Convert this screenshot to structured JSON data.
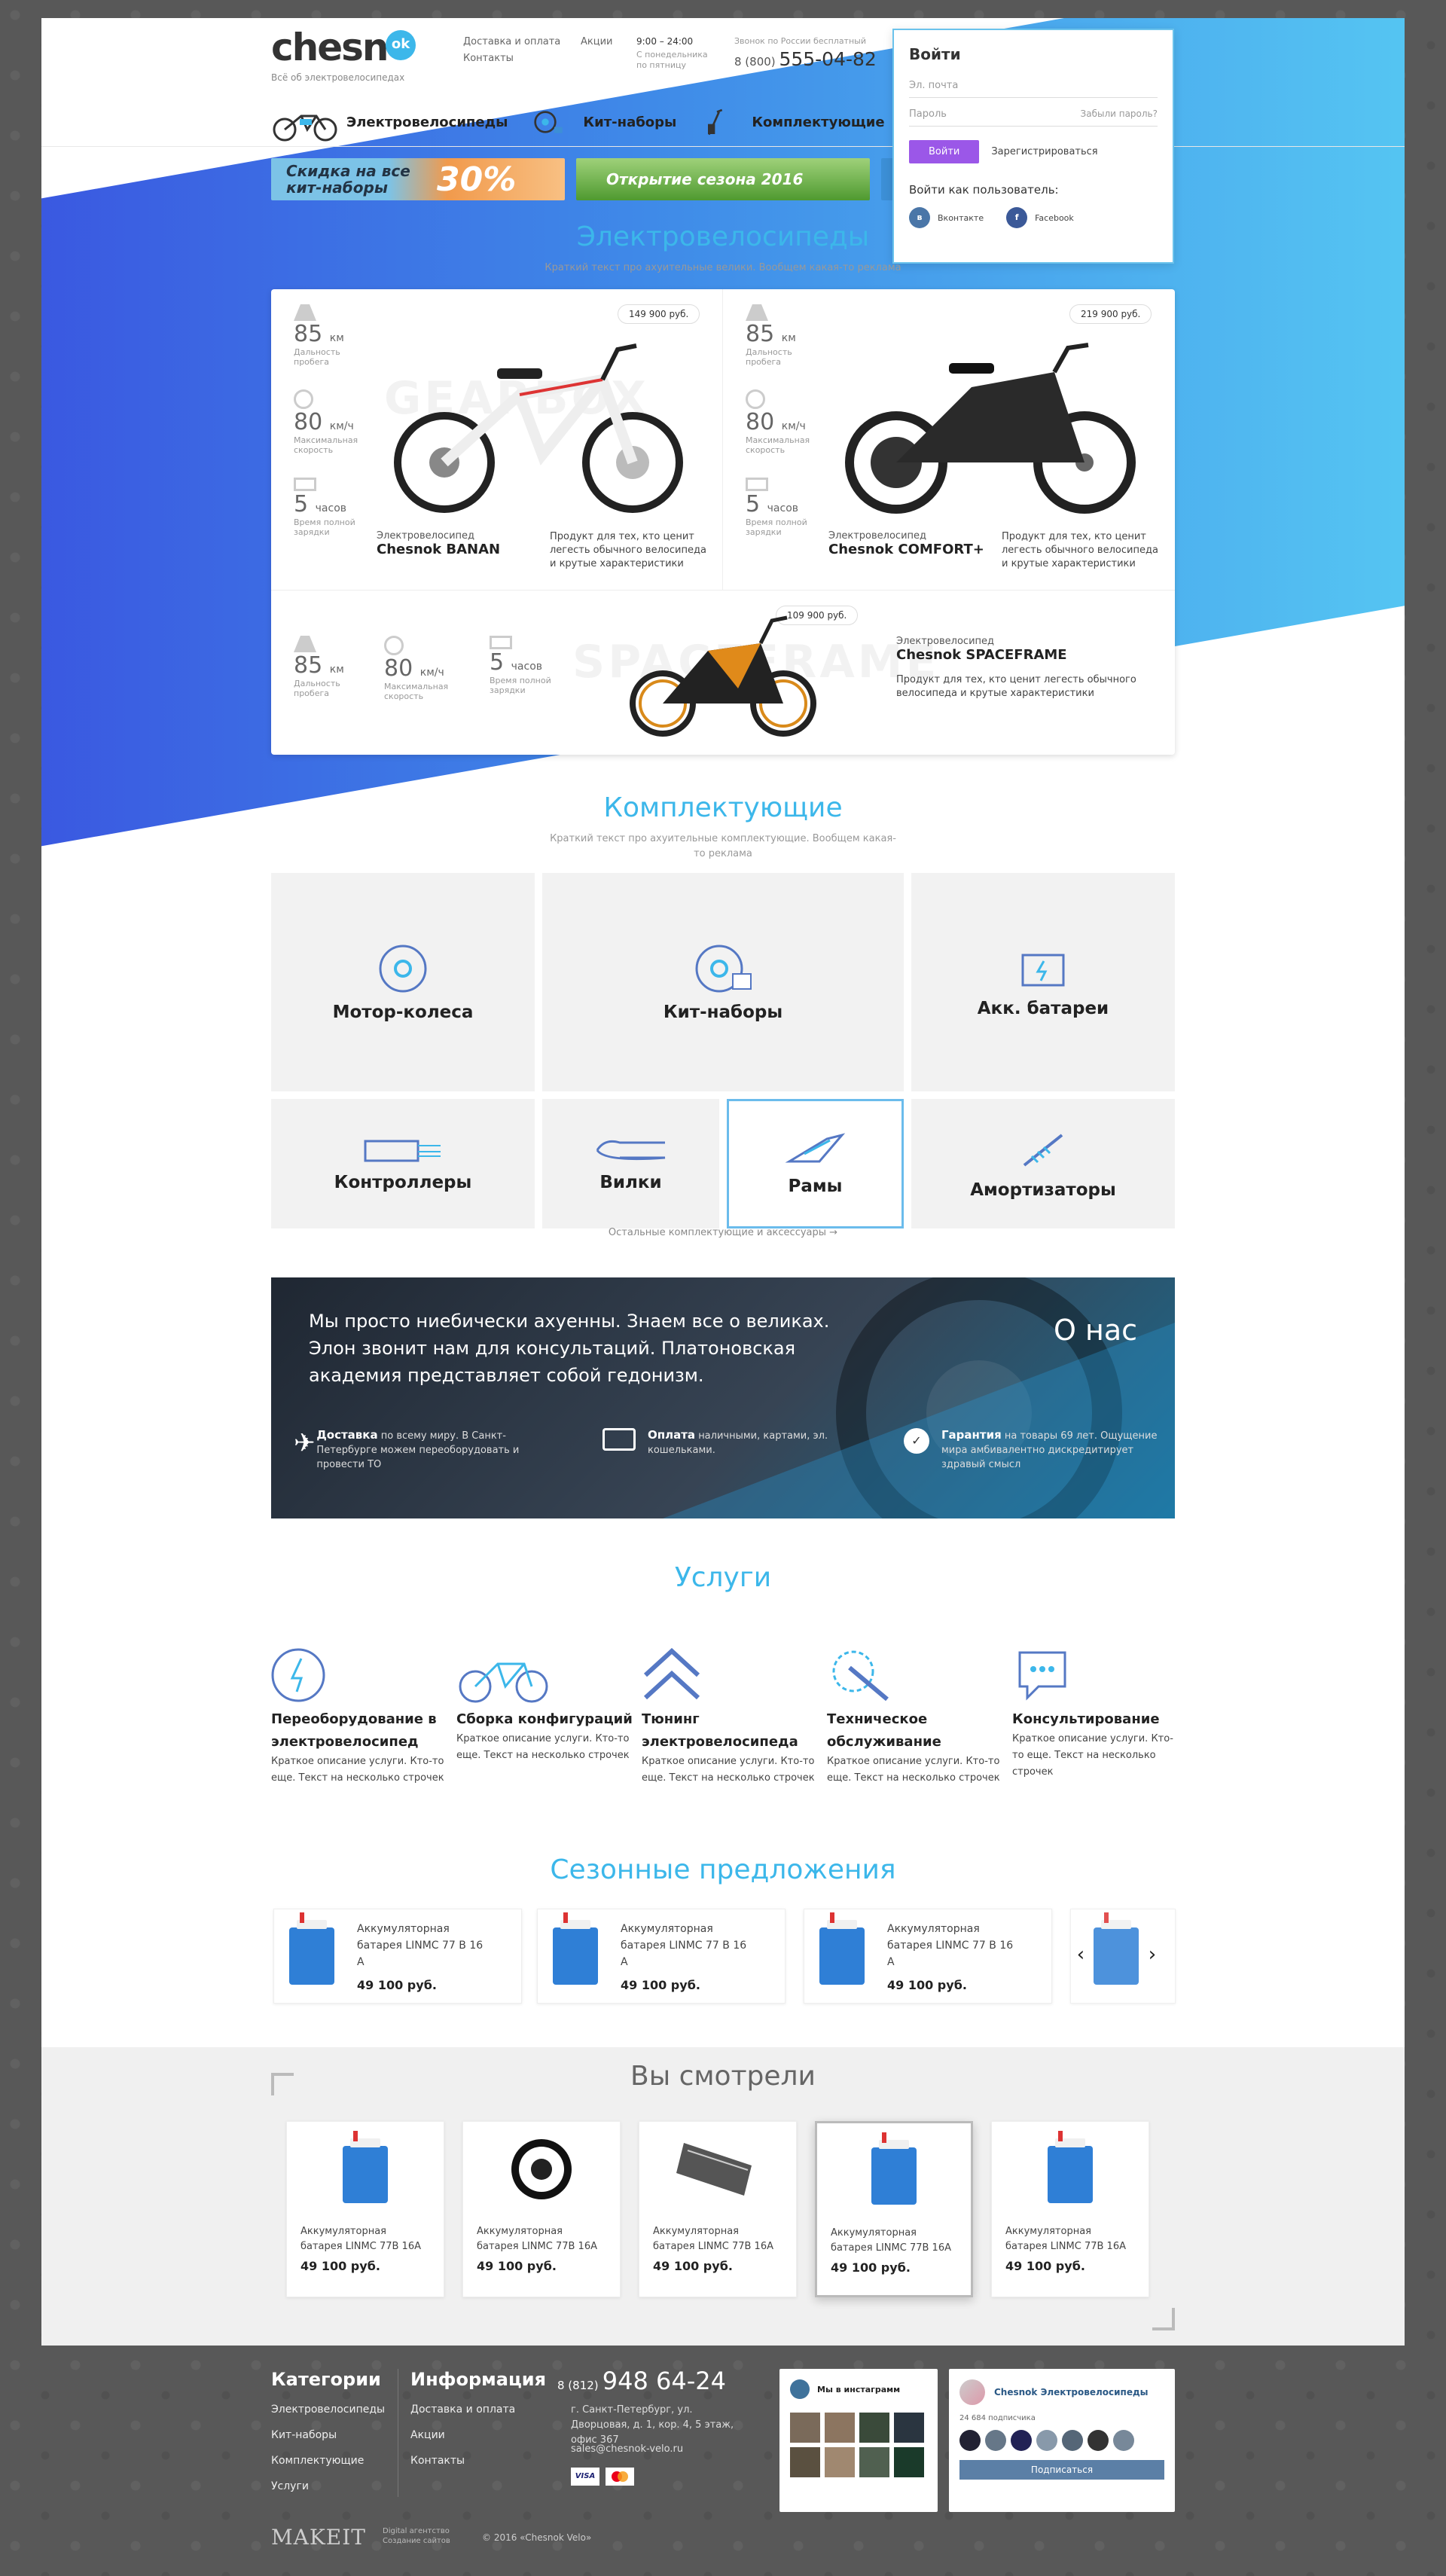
{
  "header": {
    "logo_text": "chesn",
    "logo_badge": "ok",
    "tagline": "Всё об электровелосипедах",
    "links": [
      "Доставка и оплата",
      "Контакты",
      "Акции"
    ],
    "hours": "9:00 – 24:00",
    "hours_note": "С понедельника по пятницу",
    "phone_note": "Звонок по России бесплатный",
    "phone_prefix": "8 (800)",
    "phone_number": "555-04-82"
  },
  "nav": [
    {
      "label": "Электровелосипеды",
      "icon": "bike-icon"
    },
    {
      "label": "Кит-наборы",
      "icon": "kit-icon"
    },
    {
      "label": "Комплектующие",
      "icon": "scooter-icon"
    }
  ],
  "banners": [
    {
      "text": "Скидка на все кит-наборы",
      "badge": "30%",
      "color": "#f3a05a"
    },
    {
      "text": "Открытие сезона 2016",
      "color": "#4fa33c"
    }
  ],
  "login": {
    "title": "Войти",
    "email_placeholder": "Эл. почта",
    "password_placeholder": "Пароль",
    "forgot": "Забыли пароль?",
    "submit": "Войти",
    "register": "Зарегистрироваться",
    "social_title": "Войти как пользователь:",
    "vk": "Вконтакте",
    "fb": "Facebook"
  },
  "ebikes": {
    "title": "Электровелосипеды",
    "subtitle": "Краткий текст про ахуительные велики. Вообщем какая-то реклама",
    "items": [
      {
        "ghost": "GEARBOX",
        "price": "149 900 руб.",
        "km": "85",
        "km_unit": "км",
        "km_label": "Дальность пробега",
        "speed": "80",
        "speed_unit": "км/ч",
        "speed_label": "Максимальная скорость",
        "hours": "5",
        "hours_unit": "часов",
        "hours_label": "Время полной зарядки",
        "type": "Электровелосипед",
        "name": "Chesnok BANAN",
        "desc": "Продукт для тех, кто ценит легесть обычного велосипеда и крутые характеристики"
      },
      {
        "ghost": "",
        "price": "219 900 руб.",
        "km": "85",
        "km_unit": "км",
        "km_label": "Дальность пробега",
        "speed": "80",
        "speed_unit": "км/ч",
        "speed_label": "Максимальная скорость",
        "hours": "5",
        "hours_unit": "часов",
        "hours_label": "Время полной зарядки",
        "type": "Электровелосипед",
        "name": "Chesnok COMFORT+",
        "desc": "Продукт для тех, кто ценит легесть обычного велосипеда и крутые характеристики"
      },
      {
        "ghost": "SPACEFRAME",
        "price": "109 900 руб.",
        "km": "85",
        "km_unit": "км",
        "km_label": "Дальность пробега",
        "speed": "80",
        "speed_unit": "км/ч",
        "speed_label": "Максимальная скорость",
        "hours": "5",
        "hours_unit": "часов",
        "hours_label": "Время полной зарядки",
        "type": "Электровелосипед",
        "name": "Chesnok SPACEFRAME",
        "desc": "Продукт для тех, кто ценит легесть обычного велосипеда и крутые характеристики"
      }
    ]
  },
  "components": {
    "title": "Комплектующие",
    "subtitle": "Краткий текст про ахуительные комплектующие. Вообщем какая-то реклама",
    "tiles": [
      "Мотор-колеса",
      "Кит-наборы",
      "Акк. батареи",
      "Контроллеры",
      "Вилки",
      "Рамы",
      "Амортизаторы"
    ],
    "more": "Остальные комплектующие и аксессуары →"
  },
  "about": {
    "text": "Мы просто ниебически ахуенны. Знаем все о великах. Элон звонит нам для консультаций. Платоновская академия представляет собой гедонизм.",
    "title": "О нас",
    "features": [
      {
        "bold": "Доставка",
        "text": "по всему миру. В Санкт-Петербурге можем переоборудовать и провести ТО"
      },
      {
        "bold": "Оплата",
        "text": "наличными, картами, эл. кошельками."
      },
      {
        "bold": "Гарантия",
        "text": "на товары 69 лет. Ощущение мира амбивалентно дискредитирует здравый смысл"
      }
    ]
  },
  "services": {
    "title": "Услуги",
    "items": [
      {
        "title": "Переоборудование в электровелосипед",
        "desc": "Краткое описание услуги. Кто-то еще. Текст на несколько строчек"
      },
      {
        "title": "Сборка конфигураций",
        "desc": "Краткое описание услуги. Кто-то еще. Текст на несколько строчек"
      },
      {
        "title": "Тюнинг электровелосипеда",
        "desc": "Краткое описание услуги. Кто-то еще. Текст на несколько строчек"
      },
      {
        "title": "Техническое обслуживание",
        "desc": "Краткое описание услуги. Кто-то еще. Текст на несколько строчек"
      },
      {
        "title": "Консультирование",
        "desc": "Краткое описание услуги. Кто-то еще. Текст на несколько строчек"
      }
    ]
  },
  "seasonal": {
    "title": "Сезонные предложения",
    "items": [
      {
        "name": "Аккумуляторная батарея LINMC 77 В 16 А",
        "price": "49 100 руб."
      },
      {
        "name": "Аккумуляторная батарея LINMC 77 В 16 А",
        "price": "49 100 руб."
      },
      {
        "name": "Аккумуляторная батарея LINMC 77 В 16 А",
        "price": "49 100 руб."
      }
    ]
  },
  "viewed": {
    "title": "Вы смотрели",
    "items": [
      {
        "name": "Аккумуляторная батарея LINMC 77В 16А",
        "price": "49 100 руб.",
        "img": "battery"
      },
      {
        "name": "Аккумуляторная батарея LINMC 77В 16А",
        "price": "49 100 руб.",
        "img": "wheel"
      },
      {
        "name": "Аккумуляторная батарея LINMC 77В 16А",
        "price": "49 100 руб.",
        "img": "controller"
      },
      {
        "name": "Аккумуляторная батарея LINMC 77В 16А",
        "price": "49 100 руб.",
        "img": "battery"
      },
      {
        "name": "Аккумуляторная батарея LINMC 77В 16А",
        "price": "49 100 руб.",
        "img": "battery"
      }
    ]
  },
  "footer": {
    "cat_title": "Категории",
    "cats": [
      "Электровелосипеды",
      "Кит-наборы",
      "Комплектующие",
      "Услуги"
    ],
    "info_title": "Информация",
    "infos": [
      "Доставка и оплата",
      "Акции",
      "Контакты"
    ],
    "phone_prefix": "8 (812)",
    "phone": "948 64-24",
    "address": "г. Санкт-Петербург, ул. Дворцовая, д. 1, кор. 4, 5 этаж, офис 367",
    "email": "sales@chesnok-velo.ru",
    "insta_title": "Мы в инстаграмм",
    "vk_title": "Chesnok Электровелосипеды",
    "vk_count": "24 684 подписчика",
    "vk_button": "Подписаться",
    "makeit": "MAKEIT",
    "makeit_sub": "Digital агентство Создание сайтов",
    "copyright": "© 2016 «Chesnok Velo»"
  },
  "colors": {
    "accent": "#3cb7ea",
    "purple": "#9b57e8",
    "footer": "#585858"
  }
}
